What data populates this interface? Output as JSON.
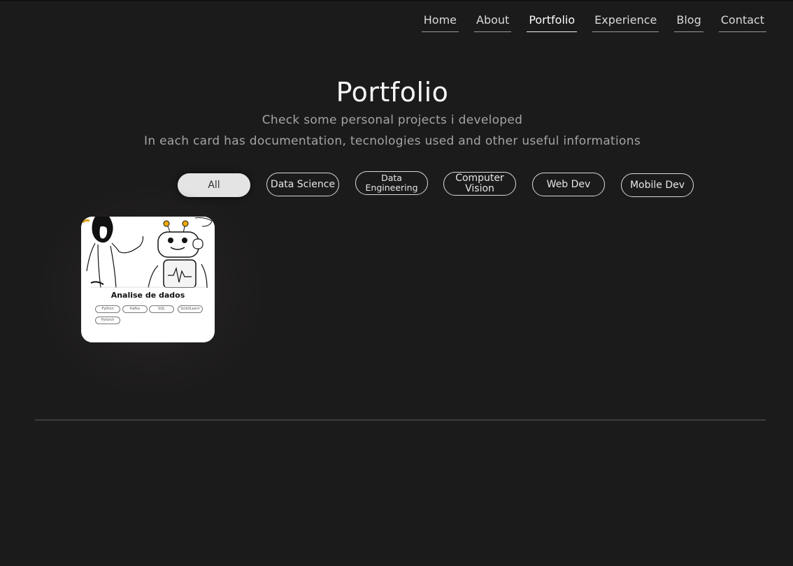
{
  "nav": {
    "items": [
      {
        "label": "Home",
        "active": false
      },
      {
        "label": "About",
        "active": false
      },
      {
        "label": "Portfolio",
        "active": true
      },
      {
        "label": "Experience",
        "active": false
      },
      {
        "label": "Blog",
        "active": false
      },
      {
        "label": "Contact",
        "active": false
      }
    ]
  },
  "header": {
    "title": "Portfolio",
    "subtitle_line1": "Check some personal projects i developed",
    "subtitle_line2": "In each card has documentation, tecnologies used and other useful informations"
  },
  "filters": {
    "items": [
      {
        "label": "All",
        "active": true
      },
      {
        "label": "Data Science",
        "active": false
      },
      {
        "label": "Data Engineering",
        "active": false
      },
      {
        "label": "Computer Vision",
        "active": false
      },
      {
        "label": "Web Dev",
        "active": false
      },
      {
        "label": "Mobile Dev",
        "active": false
      }
    ]
  },
  "projects": [
    {
      "title": "Analise de dados",
      "tags": [
        "Python",
        "Kafka",
        "SQL",
        "ScikitLearn",
        "Pytorch"
      ]
    }
  ],
  "colors": {
    "background": "#1c1b1b",
    "active_filter_bg": "#e4e4e4",
    "card_bg": "#ffffff"
  }
}
